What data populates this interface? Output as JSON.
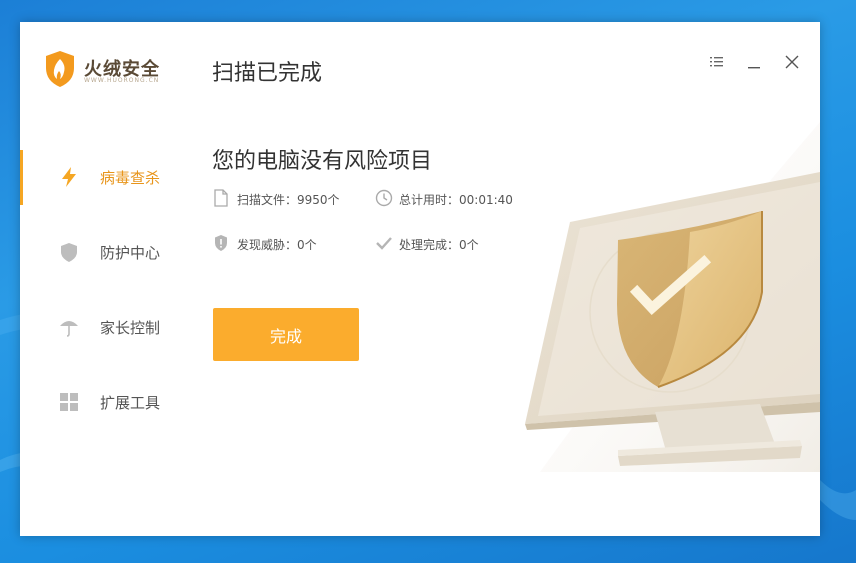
{
  "brand": {
    "name": "火绒安全",
    "url": "WWW.HUORONG.CN"
  },
  "header": {
    "title": "扫描已完成"
  },
  "window_controls": [
    "menu-icon",
    "minimize-icon",
    "close-icon"
  ],
  "sidebar": {
    "items": [
      {
        "label": "病毒查杀",
        "icon": "lightning-icon",
        "active": true
      },
      {
        "label": "防护中心",
        "icon": "shield-icon",
        "active": false
      },
      {
        "label": "家长控制",
        "icon": "umbrella-icon",
        "active": false
      },
      {
        "label": "扩展工具",
        "icon": "grid-icon",
        "active": false
      }
    ]
  },
  "result": {
    "title": "您的电脑没有风险项目",
    "stats": {
      "files_scanned": "扫描文件：9950个",
      "time_used": "总计用时：00:01:40",
      "threats_found": "发现威胁：0个",
      "handled": "处理完成：0个"
    },
    "done_button": "完成"
  },
  "colors": {
    "accent": "#f5a623",
    "button": "#fbac2d",
    "active_text": "#e8951b"
  }
}
